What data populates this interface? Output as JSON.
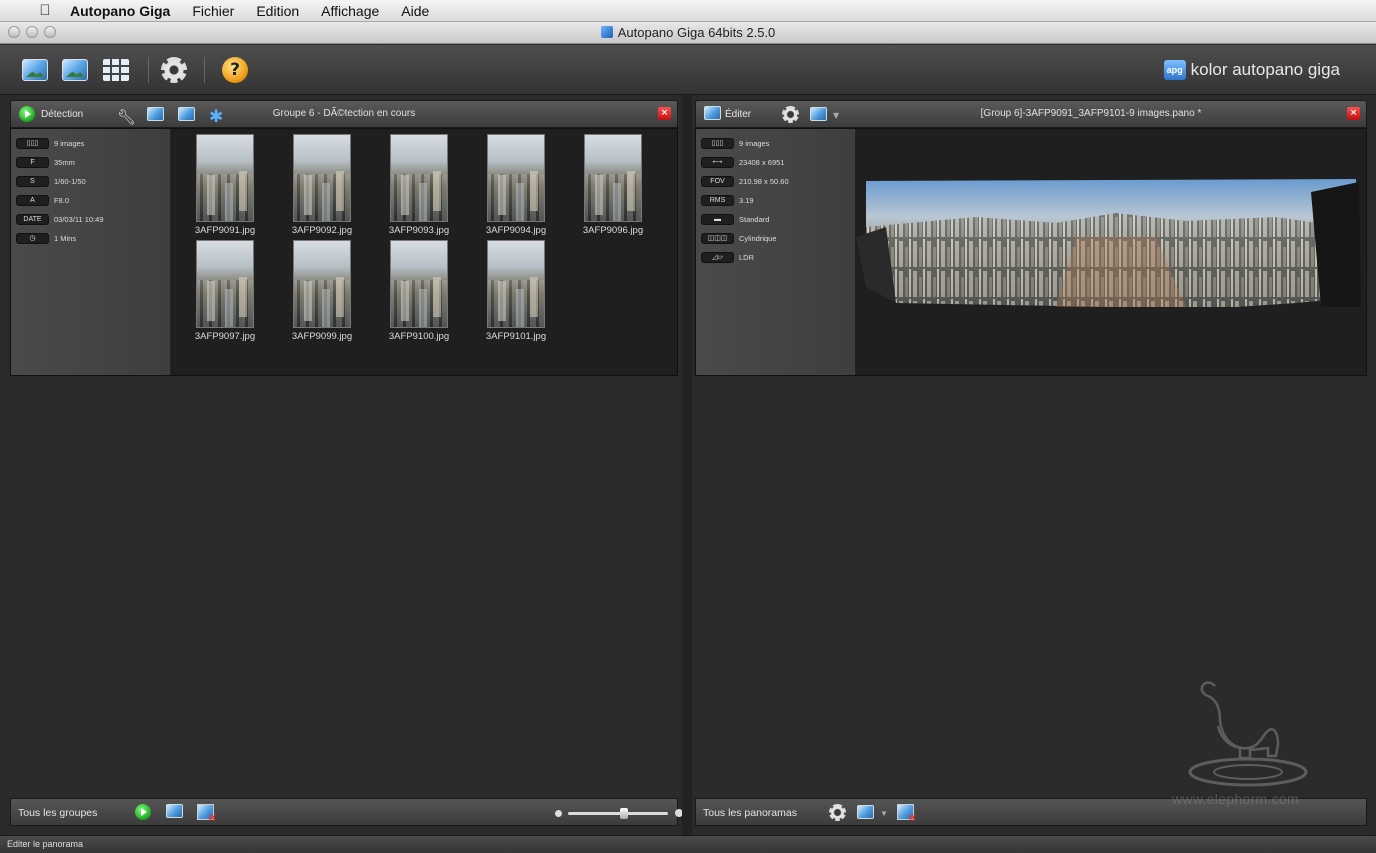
{
  "menubar": {
    "app_name": "Autopano Giga",
    "items": [
      "Fichier",
      "Edition",
      "Affichage",
      "Aide"
    ]
  },
  "window": {
    "title": "Autopano Giga 64bits 2.5.0"
  },
  "brand": {
    "logo_text": "apg",
    "name": "kolor autopano giga"
  },
  "left_panel": {
    "detect_label": "Détection",
    "title": "Groupe 6 - DÃ©tection en cours",
    "info": [
      {
        "tag": "▯▯▯",
        "value": "9 images"
      },
      {
        "tag": "F",
        "value": "35mm"
      },
      {
        "tag": "S",
        "value": "1/60-1/50"
      },
      {
        "tag": "A",
        "value": "F8.0"
      },
      {
        "tag": "DATE",
        "value": "03/03/11 10:49"
      },
      {
        "tag": "◷",
        "value": "1 Mins"
      }
    ],
    "thumbnails": [
      "3AFP9091.jpg",
      "3AFP9092.jpg",
      "3AFP9093.jpg",
      "3AFP9094.jpg",
      "3AFP9096.jpg",
      "3AFP9097.jpg",
      "3AFP9099.jpg",
      "3AFP9100.jpg",
      "3AFP9101.jpg"
    ],
    "footer_label": "Tous les groupes"
  },
  "right_panel": {
    "edit_label": "Éditer",
    "title": "[Group 6]-3AFP9091_3AFP9101-9 images.pano *",
    "info": [
      {
        "tag": "▯▯▯",
        "value": "9 images"
      },
      {
        "tag": "⟷",
        "value": "23408 x 6951"
      },
      {
        "tag": "FOV",
        "value": "210.98 x 50.60"
      },
      {
        "tag": "RMS",
        "value": "3.19"
      },
      {
        "tag": "▬",
        "value": "Standard"
      },
      {
        "tag": "◫◫◫",
        "value": "Cylindrique"
      },
      {
        "tag": "◿▱",
        "value": "LDR"
      }
    ],
    "footer_label": "Tous les panoramas"
  },
  "watermark": "www.elephorm.com",
  "status": "Editer le panorama",
  "colors": {
    "close": "#d41414",
    "play": "#2cbf2c",
    "accent": "#4d9be0"
  }
}
